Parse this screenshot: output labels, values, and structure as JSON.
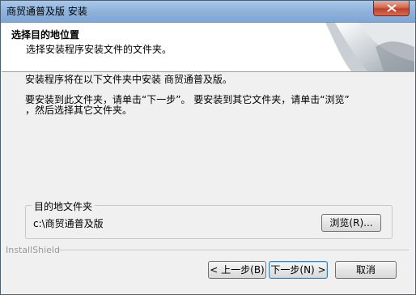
{
  "window": {
    "title": "商贸通普及版 安装"
  },
  "header": {
    "title": "选择目的地位置",
    "subtitle": "选择安装程序安装文件的文件夹。"
  },
  "body": {
    "line1": "安装程序将在以下文件夹中安装 商贸通普及版。",
    "line2": "要安装到此文件夹，请单击“下一步”。 要安装到其它文件夹，请单击“浏览”",
    "line3": "，然后选择其它文件夹。"
  },
  "destination": {
    "legend": "目的地文件夹",
    "path": "c:\\商贸通普及版",
    "browse_label": "浏览(R)..."
  },
  "footer": {
    "brand": "InstallShield",
    "back_label": "< 上一步(B)",
    "next_label": "下一步(N) >",
    "cancel_label": "取消"
  },
  "colors": {
    "titlebar": "#8fb3dc",
    "close_button": "#c0402a",
    "dialog_bg": "#f0f0f0"
  }
}
